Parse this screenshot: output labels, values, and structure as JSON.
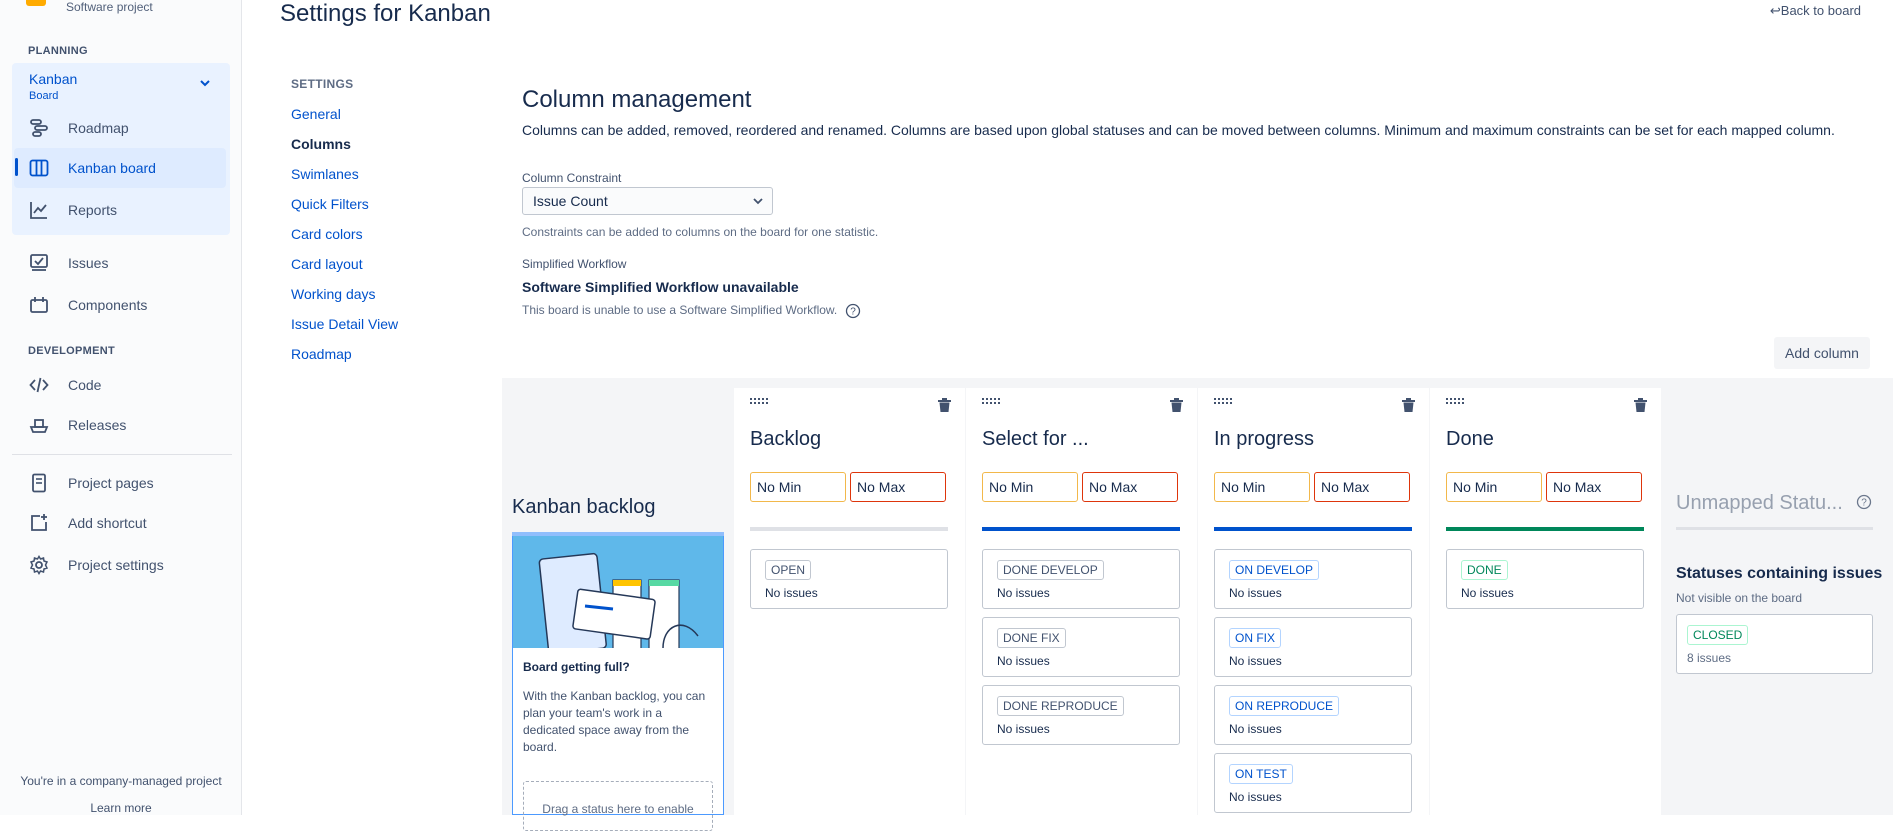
{
  "sidebar": {
    "project_sub": "Software project",
    "planning_heading": "PLANNING",
    "board": {
      "name": "Kanban",
      "type": "Board"
    },
    "planning_items": [
      {
        "label": "Roadmap",
        "icon": "roadmap-icon"
      },
      {
        "label": "Kanban board",
        "icon": "board-icon",
        "active": true
      },
      {
        "label": "Reports",
        "icon": "chart-icon"
      },
      {
        "label": "Issues",
        "icon": "issues-icon"
      },
      {
        "label": "Components",
        "icon": "components-icon"
      }
    ],
    "development_heading": "DEVELOPMENT",
    "dev_items": [
      {
        "label": "Code",
        "icon": "code-icon"
      },
      {
        "label": "Releases",
        "icon": "ship-icon"
      }
    ],
    "other_items": [
      {
        "label": "Project pages",
        "icon": "page-icon"
      },
      {
        "label": "Add shortcut",
        "icon": "add-shortcut-icon"
      },
      {
        "label": "Project settings",
        "icon": "gear-icon"
      }
    ],
    "footer_text": "You're in a company-managed project",
    "learn_more": "Learn more"
  },
  "header": {
    "title": "Settings for Kanban",
    "back_link": "Back to board"
  },
  "settings_nav": {
    "heading": "SETTINGS",
    "items": [
      "General",
      "Columns",
      "Swimlanes",
      "Quick Filters",
      "Card colors",
      "Card layout",
      "Working days",
      "Issue Detail View",
      "Roadmap"
    ],
    "current": "Columns"
  },
  "column_management": {
    "title": "Column management",
    "description": "Columns can be added, removed, reordered and renamed. Columns are based upon global statuses and can be moved between columns. Minimum and maximum constraints can be set for each mapped column.",
    "constraint_label": "Column Constraint",
    "constraint_value": "Issue Count",
    "constraint_help": "Constraints can be added to columns on the board for one statistic.",
    "workflow_label": "Simplified Workflow",
    "workflow_title": "Software Simplified Workflow unavailable",
    "workflow_help": "This board is unable to use a Software Simplified Workflow.",
    "add_column": "Add column"
  },
  "backlog": {
    "title": "Kanban backlog",
    "heading": "Board getting full?",
    "text": "With the Kanban backlog, you can plan your team's work in a dedicated space away from the board.",
    "drop_zone": "Drag a status here to enable"
  },
  "columns": [
    {
      "name": "Backlog",
      "min": "No Min",
      "max": "No Max",
      "bar_color": "#dfe1e6",
      "statuses": [
        {
          "label": "OPEN",
          "count": "No issues",
          "tone": "grey"
        }
      ]
    },
    {
      "name": "Select for ...",
      "min": "No Min",
      "max": "No Max",
      "bar_color": "#0052cc",
      "statuses": [
        {
          "label": "DONE DEVELOP",
          "count": "No issues",
          "tone": "grey"
        },
        {
          "label": "DONE FIX",
          "count": "No issues",
          "tone": "grey"
        },
        {
          "label": "DONE REPRODUCE",
          "count": "No issues",
          "tone": "grey"
        }
      ]
    },
    {
      "name": "In progress",
      "min": "No Min",
      "max": "No Max",
      "bar_color": "#0052cc",
      "statuses": [
        {
          "label": "ON DEVELOP",
          "count": "No issues",
          "tone": "blue"
        },
        {
          "label": "ON FIX",
          "count": "No issues",
          "tone": "blue"
        },
        {
          "label": "ON REPRODUCE",
          "count": "No issues",
          "tone": "blue"
        },
        {
          "label": "ON TEST",
          "count": "No issues",
          "tone": "blue"
        }
      ]
    },
    {
      "name": "Done",
      "min": "No Min",
      "max": "No Max",
      "bar_color": "#00875a",
      "statuses": [
        {
          "label": "DONE",
          "count": "No issues",
          "tone": "green"
        }
      ]
    }
  ],
  "unmapped": {
    "title": "Unmapped Statu...",
    "heading": "Statuses containing issues",
    "sub": "Not visible on the board",
    "status": {
      "label": "CLOSED",
      "count": "8 issues"
    }
  }
}
